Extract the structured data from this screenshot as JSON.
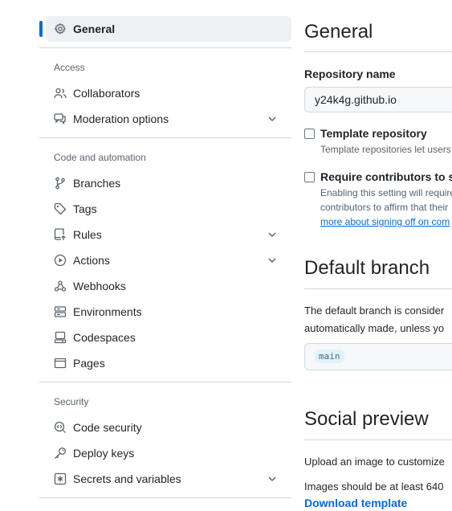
{
  "sidebar": {
    "active_item": {
      "label": "General",
      "icon": "gear-icon"
    },
    "sections": [
      {
        "title": "Access",
        "items": [
          {
            "label": "Collaborators",
            "icon": "people-icon",
            "expandable": false
          },
          {
            "label": "Moderation options",
            "icon": "comment-discussion-icon",
            "expandable": true
          }
        ]
      },
      {
        "title": "Code and automation",
        "items": [
          {
            "label": "Branches",
            "icon": "git-branch-icon",
            "expandable": false
          },
          {
            "label": "Tags",
            "icon": "tag-icon",
            "expandable": false
          },
          {
            "label": "Rules",
            "icon": "repo-push-icon",
            "expandable": true
          },
          {
            "label": "Actions",
            "icon": "play-icon",
            "expandable": true
          },
          {
            "label": "Webhooks",
            "icon": "webhook-icon",
            "expandable": false
          },
          {
            "label": "Environments",
            "icon": "server-icon",
            "expandable": false
          },
          {
            "label": "Codespaces",
            "icon": "codespaces-icon",
            "expandable": false
          },
          {
            "label": "Pages",
            "icon": "browser-icon",
            "expandable": false
          }
        ]
      },
      {
        "title": "Security",
        "items": [
          {
            "label": "Code security",
            "icon": "codescan-icon",
            "expandable": false
          },
          {
            "label": "Deploy keys",
            "icon": "key-icon",
            "expandable": false
          },
          {
            "label": "Secrets and variables",
            "icon": "key-asterisk-icon",
            "expandable": true
          }
        ]
      }
    ]
  },
  "main": {
    "general_heading": "General",
    "repo_name_label": "Repository name",
    "repo_name_value": "y24k4g.github.io",
    "template_repo": {
      "label": "Template repository",
      "checked": false,
      "note": "Template repositories let users"
    },
    "require_signoff": {
      "label": "Require contributors to sig",
      "checked": false,
      "note_line1": "Enabling this setting will require",
      "note_line2": "contributors to affirm that their",
      "link": "more about signing off on com"
    },
    "default_branch_heading": "Default branch",
    "default_branch_text_line1": "The default branch is consider",
    "default_branch_text_line2": "automatically made, unless yo",
    "default_branch_value": "main",
    "social_preview_heading": "Social preview",
    "social_text_line1": "Upload an image to customize",
    "social_text_line2": "Images should be at least 640",
    "download_template": "Download template"
  },
  "colors": {
    "accent": "#0969da",
    "active_bg": "#eef0f3",
    "muted_text": "#59636e",
    "border": "#d1d9e0"
  }
}
